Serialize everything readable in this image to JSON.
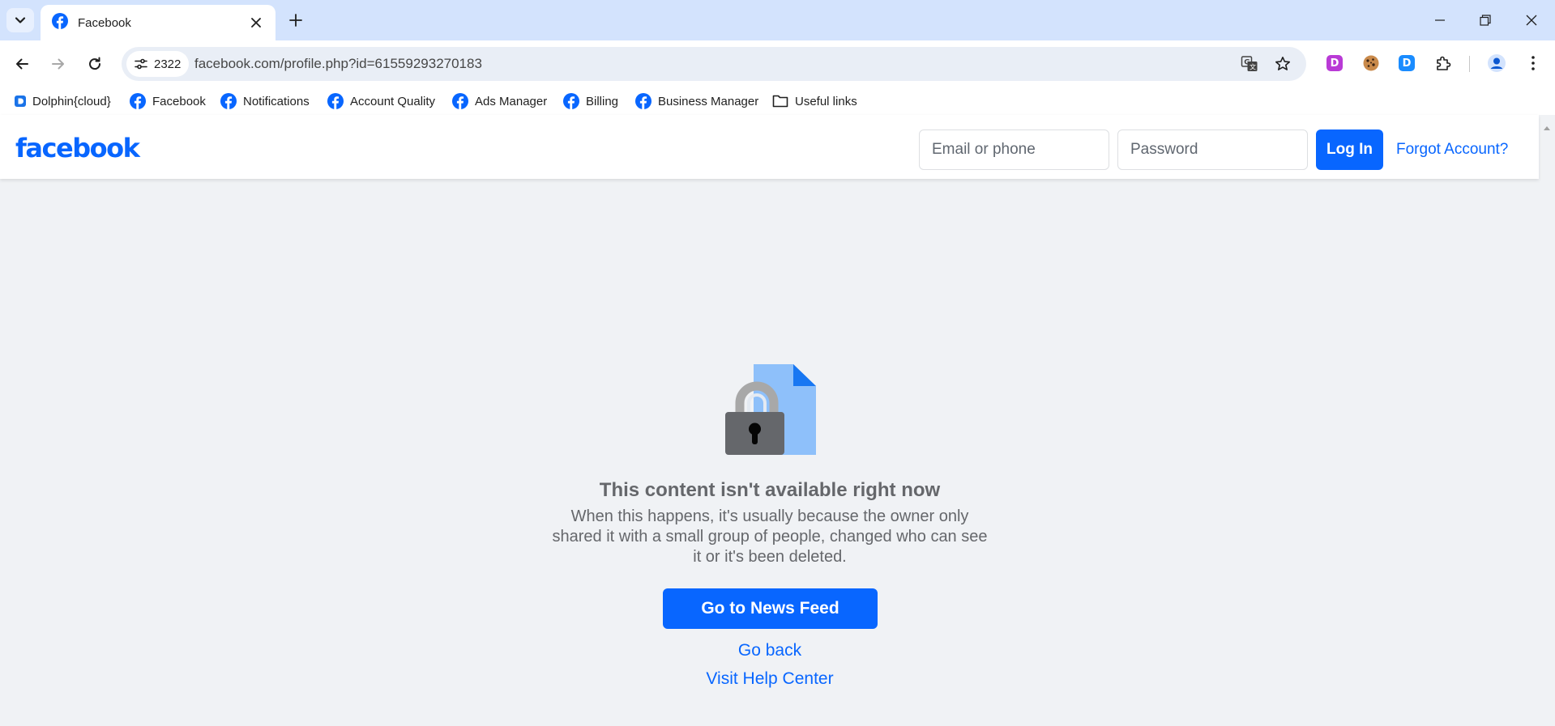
{
  "browser": {
    "tab": {
      "title": "Facebook"
    },
    "omnibox": {
      "site_chip_count": "2322",
      "url": "facebook.com/profile.php?id=61559293270183"
    },
    "bookmarks": [
      {
        "label": "Dolphin{cloud}",
        "icon": "dolphin-icon"
      },
      {
        "label": "Facebook",
        "icon": "facebook-icon"
      },
      {
        "label": "Notifications",
        "icon": "facebook-icon"
      },
      {
        "label": "Account Quality",
        "icon": "facebook-icon"
      },
      {
        "label": "Ads Manager",
        "icon": "facebook-icon"
      },
      {
        "label": "Billing",
        "icon": "facebook-icon"
      },
      {
        "label": "Business Manager",
        "icon": "facebook-icon"
      },
      {
        "label": "Useful links",
        "icon": "folder-icon"
      }
    ],
    "extensions": [
      {
        "name": "dolphin-extension-icon",
        "letter": "D",
        "color": "#b93ad6"
      },
      {
        "name": "cookie-extension-icon"
      },
      {
        "name": "dolphin-blue-extension-icon",
        "letter": "D",
        "color": "#1a8cff"
      },
      {
        "name": "extensions-puzzle-icon"
      }
    ]
  },
  "fb": {
    "logo": "facebook",
    "email_placeholder": "Email or phone",
    "password_placeholder": "Password",
    "login_label": "Log In",
    "forgot_label": "Forgot Account?"
  },
  "content": {
    "title": "This content isn't available right now",
    "body": "When this happens, it's usually because the owner only shared it with a small group of people, changed who can see it or it's been deleted.",
    "newsfeed_label": "Go to News Feed",
    "go_back_label": "Go back",
    "help_center_label": "Visit Help Center"
  },
  "colors": {
    "tabstrip": "#d3e3fd",
    "facebook_blue": "#0866ff",
    "page_bg": "#f0f2f5",
    "muted_text": "#65676b"
  }
}
